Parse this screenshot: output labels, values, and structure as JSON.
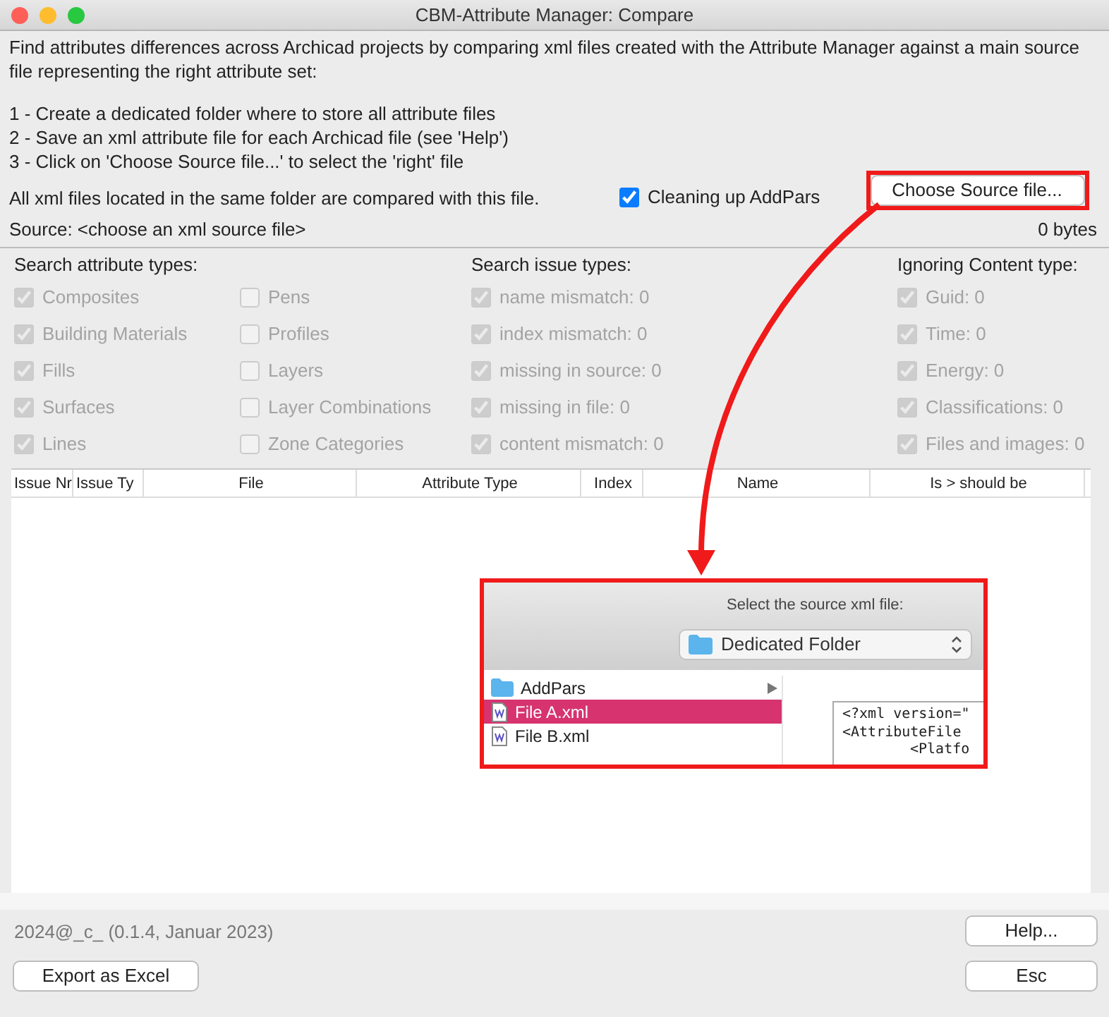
{
  "window": {
    "title": "CBM-Attribute Manager: Compare"
  },
  "intro": {
    "description": "Find attributes differences across Archicad projects by comparing xml files created with the Attribute Manager against a main source file representing the right attribute set:",
    "steps": [
      "1 - Create a dedicated folder where to store all attribute files",
      "2 - Save an xml attribute file for each Archicad file (see 'Help')",
      "3 - Click on 'Choose Source file...' to select the 'right' file"
    ],
    "note": "All xml files located in the same folder are compared with this file."
  },
  "cleanup_option": {
    "label": "Cleaning up AddPars",
    "checked": true,
    "disabled": false
  },
  "choose_button": "Choose Source file...",
  "source": {
    "label": "Source: <choose an xml source file>",
    "size": "0 bytes"
  },
  "filter_groups": [
    {
      "title": "Search attribute types:",
      "columns": [
        [
          {
            "label": "Composites",
            "checked": true,
            "disabled": true
          },
          {
            "label": "Building Materials",
            "checked": true,
            "disabled": true
          },
          {
            "label": "Fills",
            "checked": true,
            "disabled": true
          },
          {
            "label": "Surfaces",
            "checked": true,
            "disabled": true
          },
          {
            "label": "Lines",
            "checked": true,
            "disabled": true
          }
        ],
        [
          {
            "label": "Pens",
            "checked": false,
            "disabled": true
          },
          {
            "label": "Profiles",
            "checked": false,
            "disabled": true
          },
          {
            "label": "Layers",
            "checked": false,
            "disabled": true
          },
          {
            "label": "Layer Combinations",
            "checked": false,
            "disabled": true
          },
          {
            "label": "Zone Categories",
            "checked": false,
            "disabled": true
          }
        ]
      ]
    },
    {
      "title": "Search issue types:",
      "columns": [
        [
          {
            "label": "name mismatch: 0",
            "checked": true,
            "disabled": true
          },
          {
            "label": "index mismatch: 0",
            "checked": true,
            "disabled": true
          },
          {
            "label": "missing in source: 0",
            "checked": true,
            "disabled": true
          },
          {
            "label": "missing in file: 0",
            "checked": true,
            "disabled": true
          },
          {
            "label": "content mismatch: 0",
            "checked": true,
            "disabled": true
          }
        ]
      ]
    },
    {
      "title": "Ignoring Content type:",
      "columns": [
        [
          {
            "label": "Guid: 0",
            "checked": true,
            "disabled": true
          },
          {
            "label": "Time: 0",
            "checked": true,
            "disabled": true
          },
          {
            "label": "Energy: 0",
            "checked": true,
            "disabled": true
          },
          {
            "label": "Classifications: 0",
            "checked": true,
            "disabled": true
          },
          {
            "label": "Files and images: 0",
            "checked": true,
            "disabled": true
          }
        ]
      ]
    }
  ],
  "table": {
    "columns": [
      "Issue Nr",
      "Issue Ty",
      "File",
      "Attribute Type",
      "Index",
      "Name",
      "Is > should be"
    ]
  },
  "file_dialog": {
    "prompt": "Select the source xml file:",
    "folder": "Dedicated Folder",
    "files": [
      {
        "name": "AddPars",
        "kind": "folder",
        "selected": false
      },
      {
        "name": "File A.xml",
        "kind": "file",
        "selected": true
      },
      {
        "name": "File B.xml",
        "kind": "file",
        "selected": false
      }
    ],
    "preview_lines": [
      "<?xml version=\"",
      "<AttributeFile ",
      "<Platfo"
    ]
  },
  "footer": {
    "version": "2024@_c_ (0.1.4, Januar 2023)",
    "help_button": "Help...",
    "export_button": "Export as Excel",
    "esc_button": "Esc"
  }
}
